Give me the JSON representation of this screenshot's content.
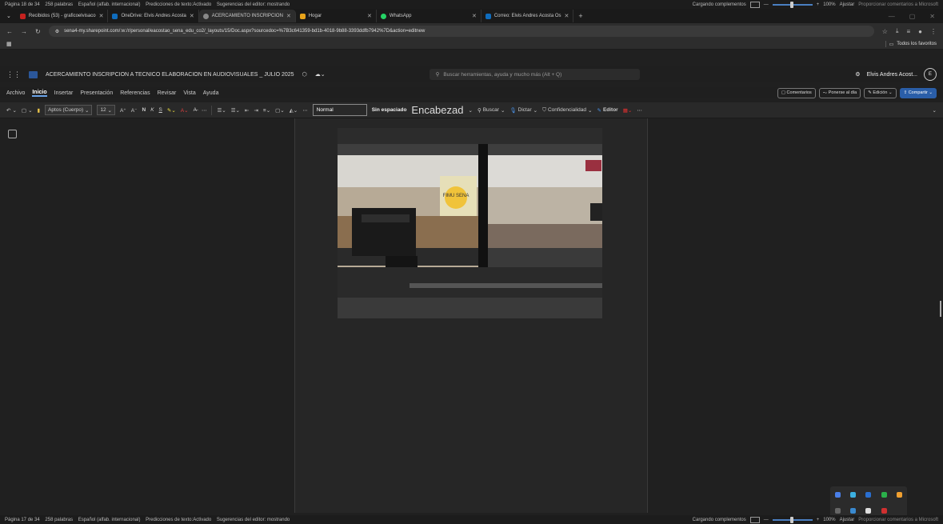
{
  "status_top": {
    "items": [
      "Página 18 de 34",
      "258 palabras",
      "Español (alfab. internacional)",
      "Predicciones de texto:Activado",
      "Sugerencias del editor: mostrando"
    ],
    "loading": "Cargando complementos",
    "zoom": "100%",
    "fit": "Ajustar",
    "feedback": "Proporcionar comentarios a Microsoft"
  },
  "tabs": [
    {
      "label": "Recibidos (53) - graficoelvisaco",
      "color": "#c5221f"
    },
    {
      "label": "OneDrive: Elvis Andres Acosta",
      "color": "#0f6cbd"
    },
    {
      "label": "ACERCAMIENTO INSCRIPCION",
      "color": "#888888"
    },
    {
      "label": "Hogar",
      "color": "#e8a31a"
    },
    {
      "label": "WhatsApp",
      "color": "#25d366"
    },
    {
      "label": "Correo: Elvis Andres Acosta Os",
      "color": "#0f6cbd"
    }
  ],
  "address": {
    "url": "sena4-my.sharepoint.com/:w:/r/personal/eacostao_sena_edu_co2/_layouts/15/Doc.aspx?sourcedoc=%7B3c641359-bd1b-4018-9b88-3393ddfb7942%7D&action=editnew"
  },
  "favorites": {
    "label": "Todos los favoritos"
  },
  "doc": {
    "title": "ACERCAMIENTO INSCRIPCION A TECNICO ELABORACION EN AUDIOVISUALES _ JULIO 2025",
    "search_placeholder": "Buscar herramientas, ayuda y mucho más (Alt + Q)",
    "user": "Elvis Andres Acost...",
    "avatar_initial": "E"
  },
  "menu": {
    "tabs": [
      "Archivo",
      "Inicio",
      "Insertar",
      "Presentación",
      "Referencias",
      "Revisar",
      "Vista",
      "Ayuda"
    ],
    "comments": "Comentarios",
    "catchup": "Ponerse al día",
    "editing": "Edición",
    "share": "Compartir"
  },
  "ribbon": {
    "font": "Aptos (Cuerpo)",
    "size": "12",
    "bold": "N",
    "italic": "K",
    "underline": "S",
    "style_normal": "Normal",
    "style_nospace": "Sin espaciado",
    "style_heading": "Encabezad",
    "find": "Buscar",
    "dictate": "Dictar",
    "sensitivity": "Confidencialidad",
    "editor": "Editor"
  },
  "status_bottom": {
    "items": [
      "Página 17 de 34",
      "258 palabras",
      "Español (alfab. internacional)",
      "Predicciones de texto:Activado",
      "Sugerencias del editor: mostrando"
    ],
    "loading": "Cargando complementos",
    "zoom": "100%",
    "fit": "Ajustar",
    "feedback": "Proporcionar comentarios a Microsoft"
  },
  "photo_sign": "FIMU SENA"
}
